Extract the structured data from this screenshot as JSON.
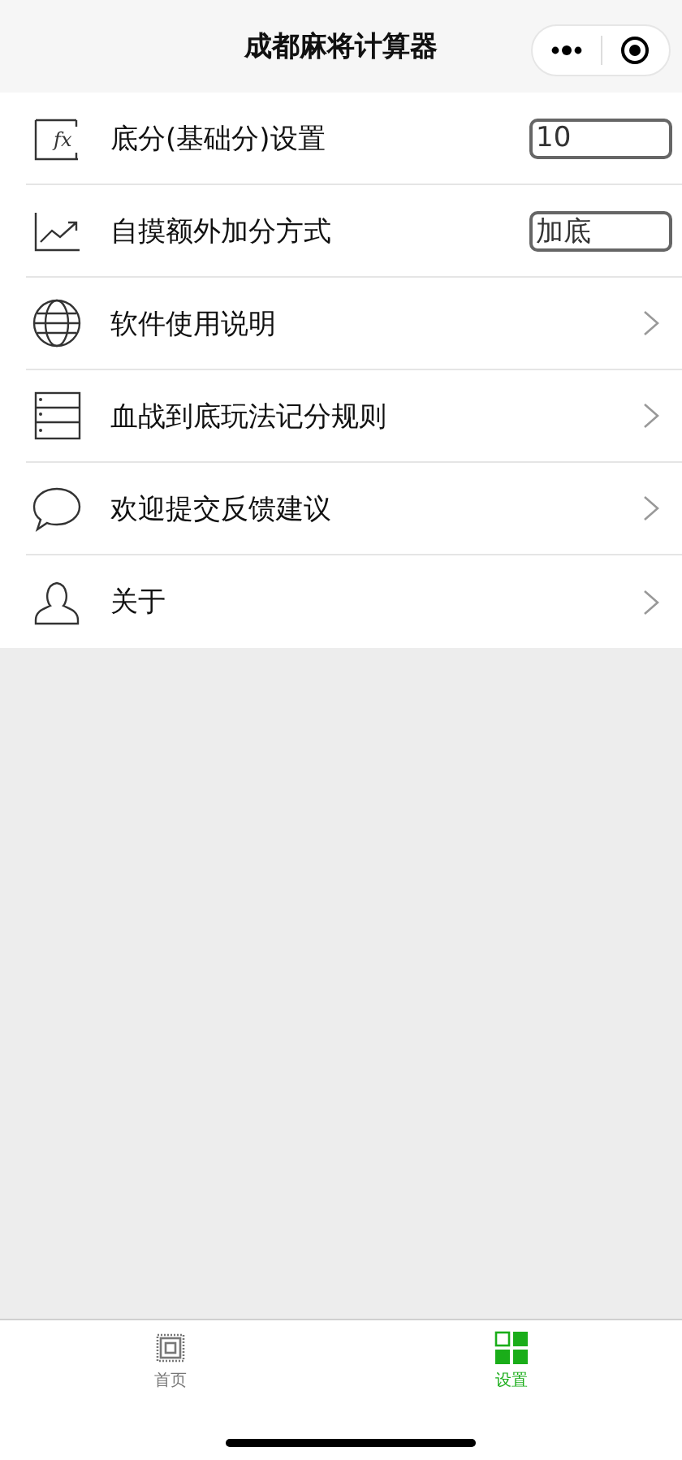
{
  "nav_bar": {
    "title": "成都麻将计算器"
  },
  "settings": [
    {
      "kind": "input",
      "icon_text": "fx",
      "label": "底分(基础分)设置",
      "value": "10"
    },
    {
      "kind": "input",
      "label": "自摸额外加分方式",
      "value": "加底"
    },
    {
      "kind": "link",
      "label": "软件使用说明"
    },
    {
      "kind": "link",
      "label": "血战到底玩法记分规则"
    },
    {
      "kind": "link",
      "label": "欢迎提交反馈建议"
    },
    {
      "kind": "link",
      "label": "关于"
    }
  ],
  "tab_bar": [
    {
      "label": "首页",
      "selected": false
    },
    {
      "label": "设置",
      "selected": true
    }
  ]
}
